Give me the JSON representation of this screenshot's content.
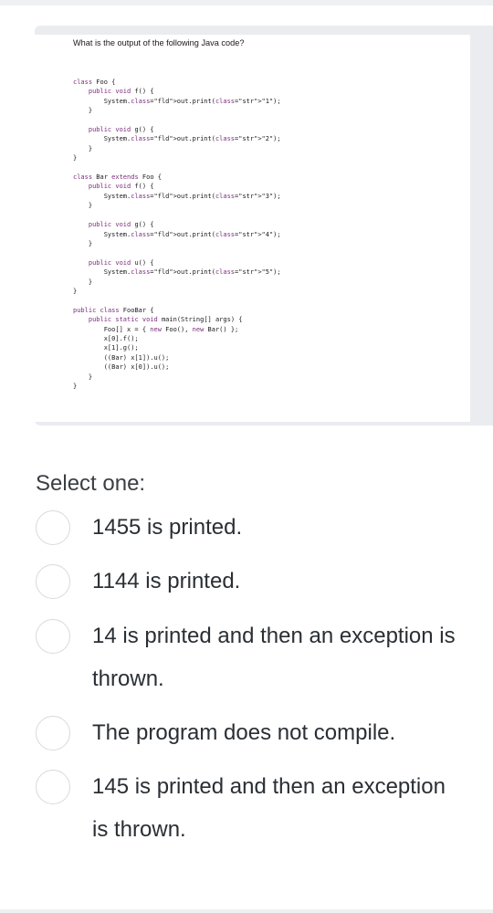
{
  "question": {
    "text": "What is the output of the following Java code?",
    "code_lines": [
      "class Foo {",
      "    public void f() {",
      "        System.out.print(\"1\");",
      "    }",
      "",
      "    public void g() {",
      "        System.out.print(\"2\");",
      "    }",
      "}",
      "",
      "class Bar extends Foo {",
      "    public void f() {",
      "        System.out.print(\"3\");",
      "    }",
      "",
      "    public void g() {",
      "        System.out.print(\"4\");",
      "    }",
      "",
      "    public void u() {",
      "        System.out.print(\"5\");",
      "    }",
      "}",
      "",
      "public class FooBar {",
      "    public static void main(String[] args) {",
      "        Foo[] x = { new Foo(), new Bar() };",
      "        x[0].f();",
      "        x[1].g();",
      "        ((Bar) x[1]).u();",
      "        ((Bar) x[0]).u();",
      "    }",
      "}"
    ]
  },
  "select_label": "Select one:",
  "options": [
    {
      "line1": "1455 is printed.",
      "line2": ""
    },
    {
      "line1": "1144 is printed.",
      "line2": ""
    },
    {
      "line1": "14 is printed and then an exception is",
      "line2": "thrown."
    },
    {
      "line1": "The program does not compile.",
      "line2": ""
    },
    {
      "line1": "145 is printed and then an exception",
      "line2": "is thrown."
    }
  ],
  "colors": {
    "keyword": "#7b2d7b",
    "string": "#1a2f9c",
    "card_bg": "#eaecef",
    "radio_border": "#d7dadd"
  }
}
